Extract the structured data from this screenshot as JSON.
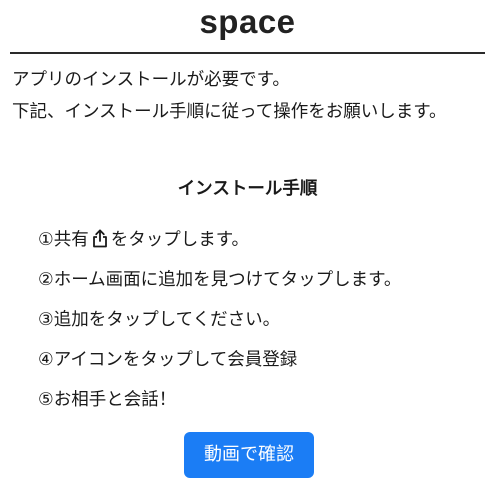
{
  "header": {
    "title": "space"
  },
  "intro": {
    "line1": "アプリのインストールが必要です。",
    "line2": "下記、インストール手順に従って操作をお願いします。"
  },
  "instructions": {
    "title": "インストール手順",
    "steps": [
      {
        "before": "①共有",
        "icon": "share-icon",
        "after": "をタップします。"
      },
      {
        "text": "②ホーム画面に追加を見つけてタップします。"
      },
      {
        "text": "③追加をタップしてください。"
      },
      {
        "text": "④アイコンをタップして会員登録"
      },
      {
        "text": "⑤お相手と会話！"
      }
    ]
  },
  "cta": {
    "label": "動画で確認",
    "color": "#1b7df5"
  },
  "colors": {
    "text": "#1a1a1a",
    "divider": "#2a2a2a",
    "background": "#ffffff"
  }
}
